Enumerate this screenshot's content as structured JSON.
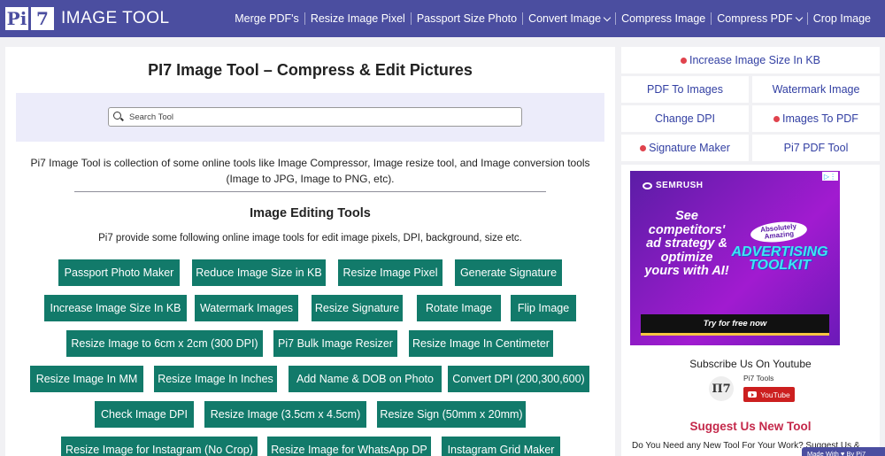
{
  "header": {
    "logo_letters": [
      "Pi",
      "7"
    ],
    "logo_text": "IMAGE TOOL",
    "nav": [
      {
        "label": "Merge PDF's",
        "dropdown": false
      },
      {
        "label": "Resize Image Pixel",
        "dropdown": false
      },
      {
        "label": "Passport Size Photo",
        "dropdown": false
      },
      {
        "label": "Convert Image",
        "dropdown": true
      },
      {
        "label": "Compress Image",
        "dropdown": false
      },
      {
        "label": "Compress PDF",
        "dropdown": true
      },
      {
        "label": "Crop Image",
        "dropdown": false
      }
    ]
  },
  "main": {
    "title": "PI7 Image Tool – Compress & Edit Pictures",
    "search_placeholder": "Search Tool",
    "intro": "Pi7 Image Tool is collection of some online tools like Image Compressor, Image resize tool, and Image conversion tools (Image to JPG, Image to PNG, etc).",
    "section_title": "Image Editing Tools",
    "section_sub": "Pi7 provide some following online image tools for edit image pixels, DPI, background, size etc.",
    "tools": [
      "Passport Photo Maker",
      "Reduce Image Size in KB",
      "Resize Image Pixel",
      "Generate Signature",
      "Increase Image Size In KB",
      "Watermark Images",
      "Resize Signature",
      "Rotate Image",
      "Flip Image",
      "Resize Image to 6cm x 2cm (300 DPI)",
      "Pi7 Bulk Image Resizer",
      "Resize Image In Centimeter",
      "Resize Image In MM",
      "Resize Image In Inches",
      "Add Name & DOB on Photo",
      "Convert DPI (200,300,600)",
      "Check Image DPI",
      "Resize Image (3.5cm x 4.5cm)",
      "Resize Sign (50mm x 20mm)",
      "Resize Image for Instagram (No Crop)",
      "Resize Image for WhatsApp DP",
      "Instagram Grid Maker"
    ]
  },
  "sidebar": {
    "links": [
      {
        "label": "Increase Image Size In KB",
        "hot": true
      },
      {
        "label": "PDF To Images",
        "hot": false
      },
      {
        "label": "Watermark Image",
        "hot": false
      },
      {
        "label": "Change DPI",
        "hot": false
      },
      {
        "label": "Images To PDF",
        "hot": true
      },
      {
        "label": "Signature Maker",
        "hot": true
      },
      {
        "label": "Pi7 PDF Tool",
        "hot": false
      }
    ],
    "ad": {
      "brand": "SEMRUSH",
      "headline": "See competitors' ad strategy & optimize yours with AI!",
      "badge_line1": "Absolutely",
      "badge_line2": "Amazing",
      "toolkit": "ADVERTISING TOOLKIT",
      "cta": "Try for free now"
    },
    "subscribe_title": "Subscribe Us On Youtube",
    "channel_logo": "Π7",
    "channel_name": "Pi7 Tools",
    "youtube_button": "YouTube",
    "suggest_title": "Suggest Us New Tool",
    "suggest_text": "Do You Need any New Tool For Your Work? Suggest Us &",
    "made_with": "Made With ♥ By Pi7"
  },
  "colors": {
    "header_bg": "#4b4ea0",
    "button_bg": "#127a6a",
    "link_color": "#3340a3",
    "hot_dot": "#e0434d",
    "suggest_color": "#c4284a"
  }
}
